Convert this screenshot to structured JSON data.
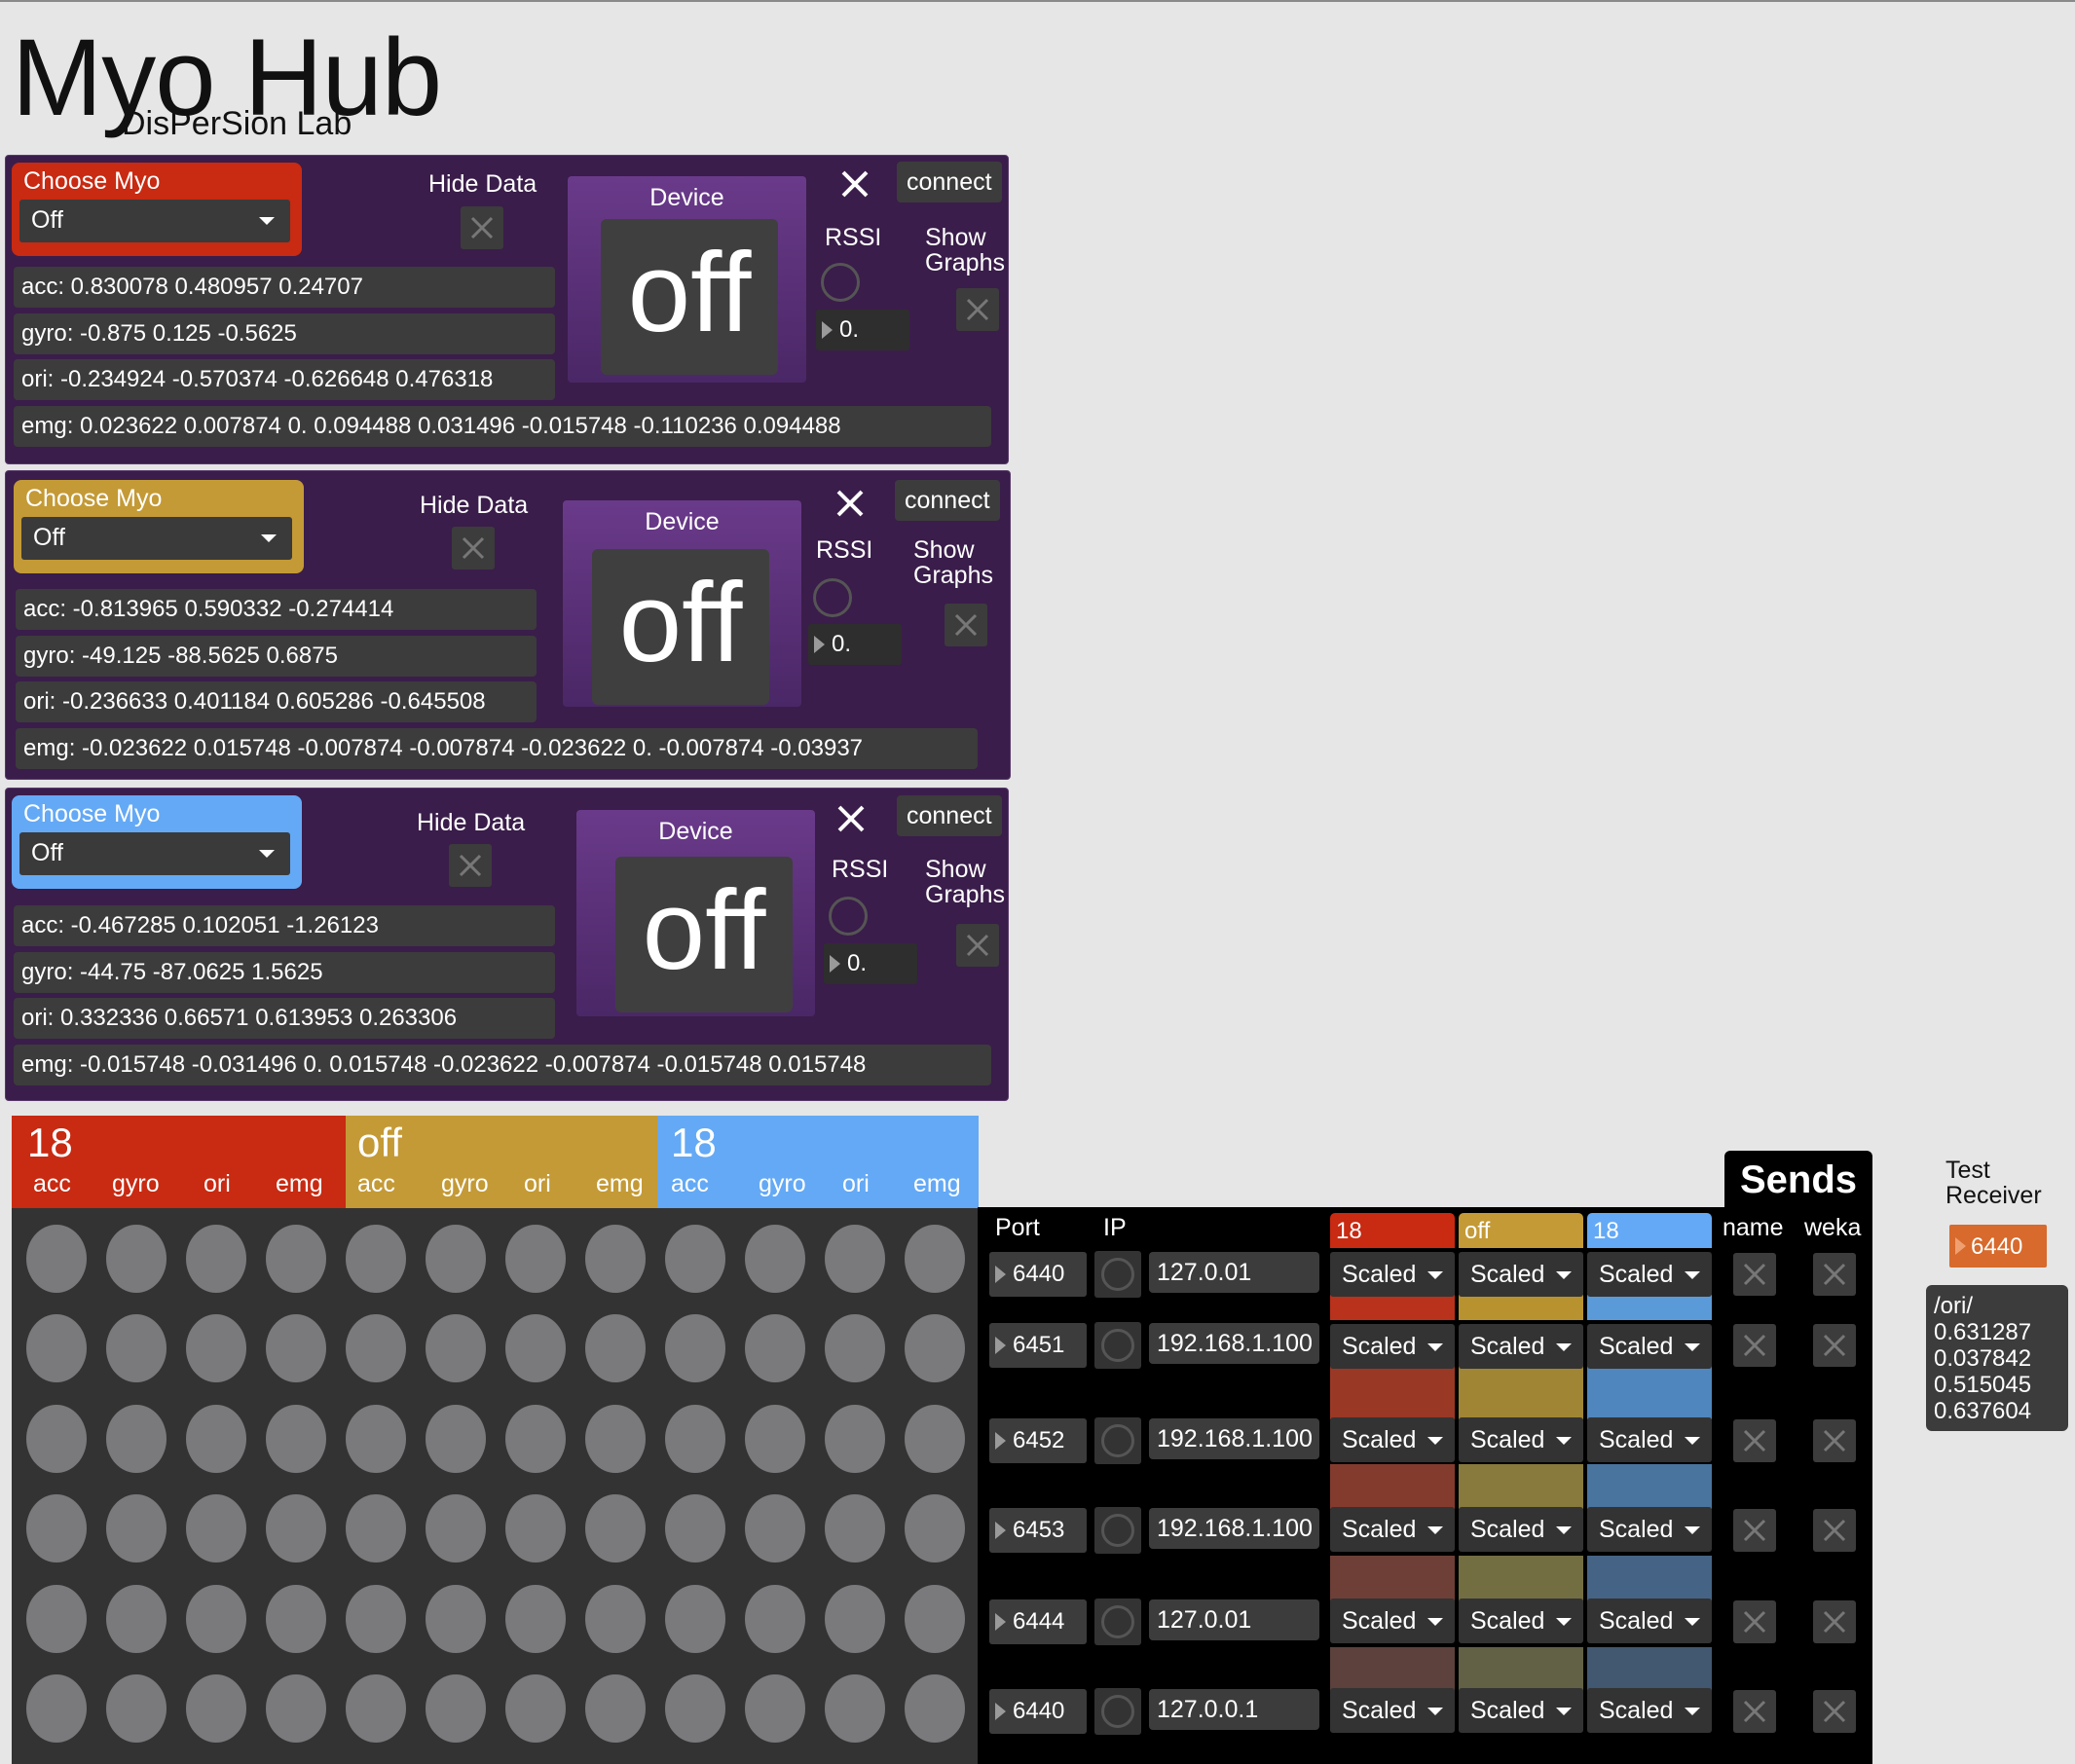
{
  "app": {
    "title": "Myo Hub",
    "subtitle": "DisPerSion Lab"
  },
  "panels": [
    {
      "accent": "#c82a12",
      "choose_label": "Choose Myo",
      "selected": "Off",
      "hide_data": "Hide Data",
      "device_label": "Device",
      "device_state": "off",
      "connect": "connect",
      "rssi": "RSSI",
      "rssi_value": "0.",
      "show_graphs": "Show Graphs",
      "acc": "acc: 0.830078 0.480957 0.24707",
      "gyro": "gyro: -0.875 0.125 -0.5625",
      "ori": "ori: -0.234924 -0.570374 -0.626648 0.476318",
      "emg": "emg: 0.023622 0.007874 0. 0.094488 0.031496 -0.015748 -0.110236 0.094488"
    },
    {
      "accent": "#c49a36",
      "choose_label": "Choose Myo",
      "selected": "Off",
      "hide_data": "Hide Data",
      "device_label": "Device",
      "device_state": "off",
      "connect": "connect",
      "rssi": "RSSI",
      "rssi_value": "0.",
      "show_graphs": "Show Graphs",
      "acc": "acc: -0.813965 0.590332 -0.274414",
      "gyro": "gyro: -49.125 -88.5625 0.6875",
      "ori": "ori: -0.236633 0.401184 0.605286 -0.645508",
      "emg": "emg: -0.023622 0.015748 -0.007874 -0.007874 -0.023622 0. -0.007874 -0.03937"
    },
    {
      "accent": "#64a9f5",
      "choose_label": "Choose Myo",
      "selected": "Off",
      "hide_data": "Hide Data",
      "device_label": "Device",
      "device_state": "off",
      "connect": "connect",
      "rssi": "RSSI",
      "rssi_value": "0.",
      "show_graphs": "Show Graphs",
      "acc": "acc: -0.467285 0.102051 -1.26123",
      "gyro": "gyro: -44.75 -87.0625 1.5625",
      "ori": "ori: 0.332336 0.66571 0.613953 0.263306",
      "emg": "emg: -0.015748 -0.031496 0. 0.015748 -0.023622 -0.007874 -0.015748 0.015748"
    }
  ],
  "matrix": {
    "groups": [
      {
        "title": "18",
        "color": "#c82a12",
        "cols": [
          "acc",
          "gyro",
          "ori",
          "emg"
        ]
      },
      {
        "title": "off",
        "color": "#c49a36",
        "cols": [
          "acc",
          "gyro",
          "ori",
          "emg"
        ]
      },
      {
        "title": "18",
        "color": "#64a9f5",
        "cols": [
          "acc",
          "gyro",
          "ori",
          "emg"
        ]
      }
    ],
    "rows": 6
  },
  "sends": {
    "title": "Sends",
    "headers": {
      "port": "Port",
      "ip": "IP",
      "name": "name",
      "weka": "weka"
    },
    "myo_headers": [
      {
        "label": "18",
        "color": "#c82a12"
      },
      {
        "label": "off",
        "color": "#c49a36"
      },
      {
        "label": "18",
        "color": "#64a9f5"
      }
    ],
    "rows": [
      {
        "port": "6440",
        "ip": "127.0.01",
        "modes": [
          "Scaled",
          "Scaled",
          "Scaled"
        ]
      },
      {
        "port": "6451",
        "ip": "192.168.1.100",
        "modes": [
          "Scaled",
          "Scaled",
          "Scaled"
        ]
      },
      {
        "port": "6452",
        "ip": "192.168.1.100",
        "modes": [
          "Scaled",
          "Scaled",
          "Scaled"
        ]
      },
      {
        "port": "6453",
        "ip": "192.168.1.100",
        "modes": [
          "Scaled",
          "Scaled",
          "Scaled"
        ]
      },
      {
        "port": "6444",
        "ip": "127.0.01",
        "modes": [
          "Scaled",
          "Scaled",
          "Scaled"
        ]
      },
      {
        "port": "6440",
        "ip": "127.0.0.1",
        "modes": [
          "Scaled",
          "Scaled",
          "Scaled"
        ]
      }
    ]
  },
  "test_receiver": {
    "label": "Test Receiver",
    "port": "6440",
    "port_color": "#d76a2c",
    "lines": [
      "/ori/",
      "0.631287",
      "0.037842",
      "0.515045",
      "0.637604"
    ]
  }
}
